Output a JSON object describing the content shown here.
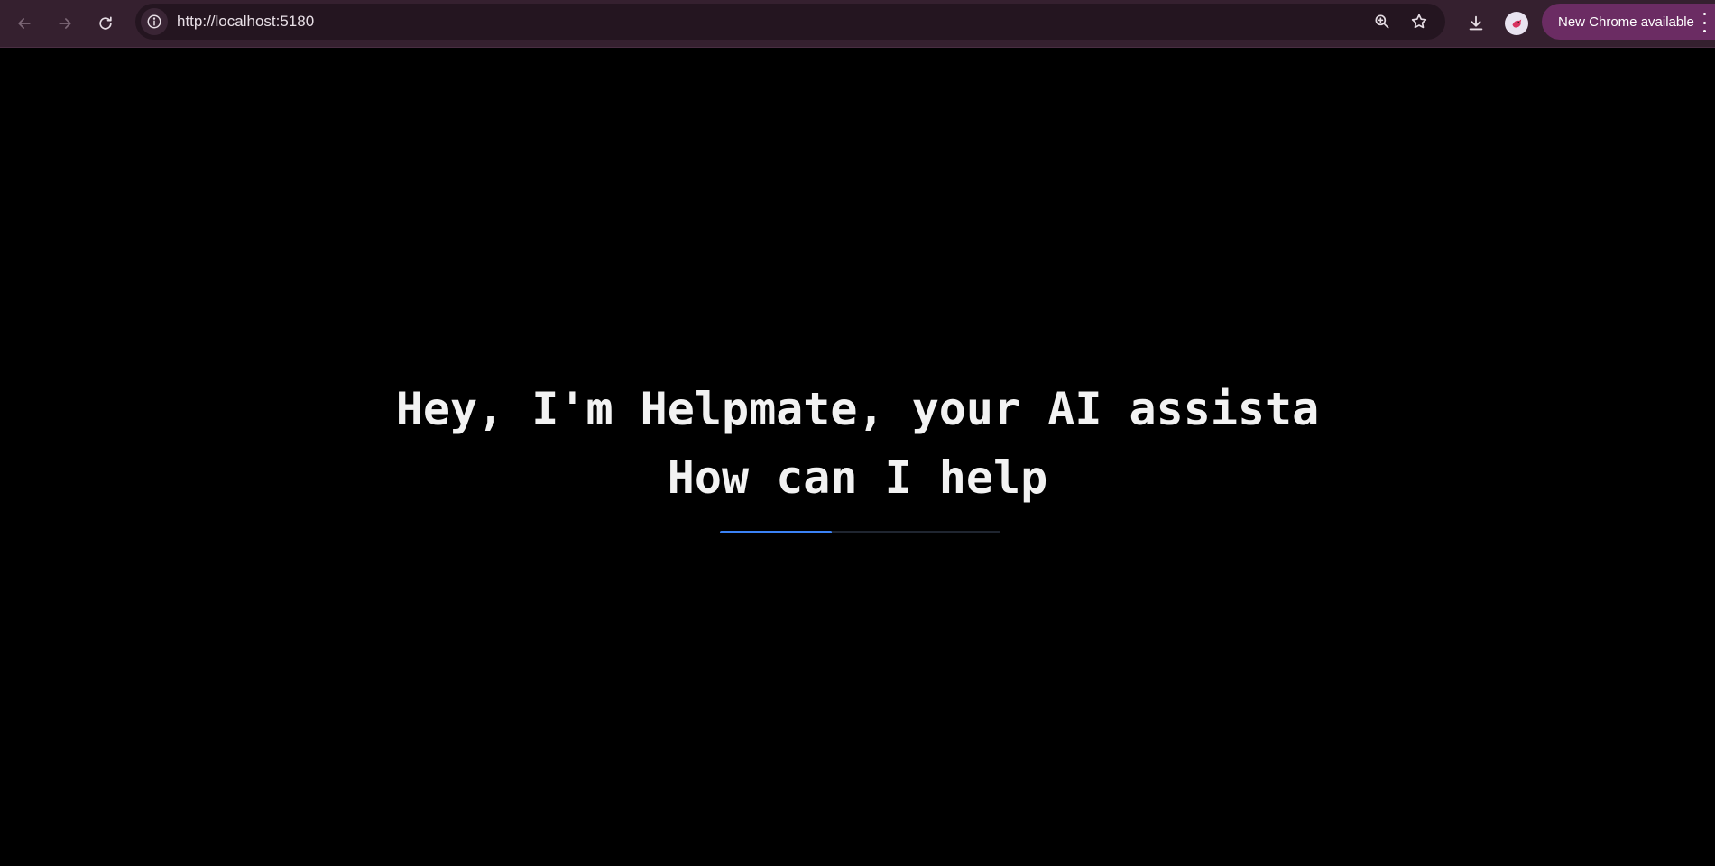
{
  "browser": {
    "url": "http://localhost:5180",
    "update_label": "New Chrome available",
    "icons": {
      "back": "arrow-left-icon",
      "forward": "arrow-right-icon",
      "reload": "reload-icon",
      "site_info": "info-icon",
      "zoom": "zoom-icon",
      "bookmark": "star-icon",
      "downloads": "download-icon",
      "profile": "avatar",
      "menu": "kebab-menu-icon"
    },
    "colors": {
      "toolbar": "#35202f",
      "omnibox": "#241520",
      "update_chip": "#6b2c63"
    }
  },
  "page": {
    "greeting_line1": "Hey, I'm Helpmate, your AI assista",
    "greeting_line2": "How can I help",
    "loader_progress": 0.4,
    "colors": {
      "background": "#000000",
      "text": "#f2f2f2",
      "loader_fill": "#3b82f6",
      "loader_track": "#1f2530"
    }
  }
}
